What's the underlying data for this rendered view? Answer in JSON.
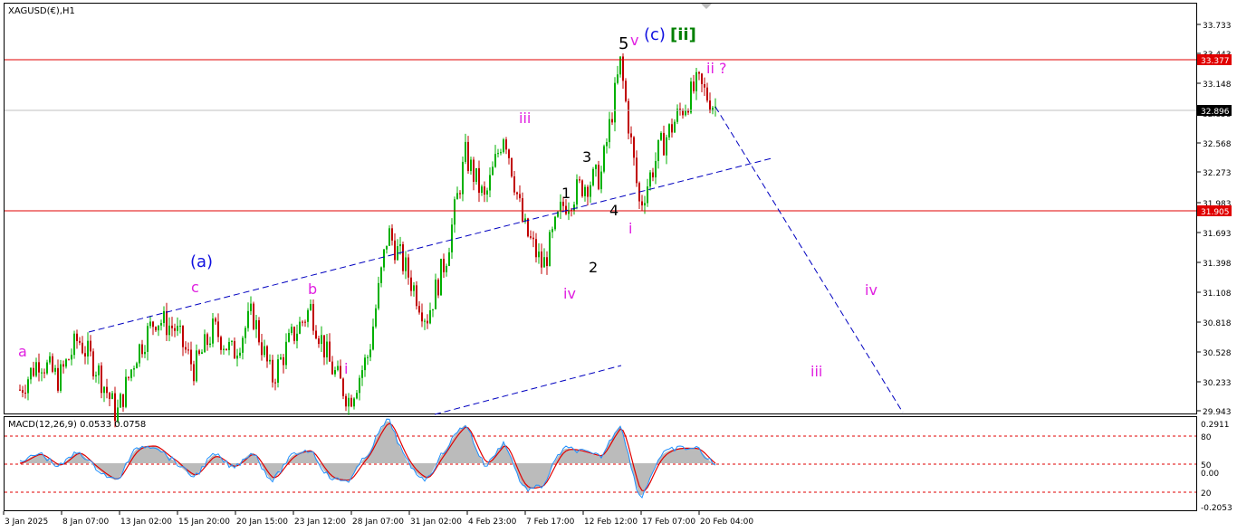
{
  "symbol_label": "XAGUSD(€),H1",
  "macd_label": "MACD(12,26,9) 0.0533 0.0758",
  "colors": {
    "bull": "#00b000",
    "bear": "#c00000",
    "wick": "#202020",
    "resistance": "#e00000",
    "price_line": "#c0c0c0",
    "channel": "#0000c0",
    "wave_pink": "#e020e0",
    "wave_blue": "#1010e0",
    "wave_green": "#008000",
    "wave_black": "#000000",
    "macd_hist": "#bbbbbb",
    "macd_signal": "#e00000",
    "macd_line": "#1e90ff"
  },
  "price_axis": {
    "ticks": [
      "33.733",
      "33.443",
      "33.148",
      "32.858",
      "32.568",
      "32.273",
      "31.983",
      "31.693",
      "31.398",
      "31.108",
      "30.818",
      "30.528",
      "30.233",
      "29.943"
    ],
    "range": [
      29.92,
      33.79
    ]
  },
  "price_tags": {
    "resistance_high": "33.377",
    "current": "32.896",
    "resistance_low": "31.905"
  },
  "macd_axis": {
    "ticks": [
      "0.2911",
      "80",
      "50",
      "0.00",
      "20",
      "-0.2053"
    ]
  },
  "time_axis": {
    "labels": [
      "3 Jan 2025",
      "8 Jan 07:00",
      "13 Jan 02:00",
      "15 Jan 20:00",
      "20 Jan 15:00",
      "23 Jan 12:00",
      "28 Jan 07:00",
      "31 Jan 02:00",
      "4 Feb 23:00",
      "7 Feb 17:00",
      "12 Feb 12:00",
      "17 Feb 07:00",
      "20 Feb 04:00"
    ]
  },
  "wave_labels": [
    {
      "text": "a",
      "color": "pink"
    },
    {
      "text": "(a)",
      "color": "blue"
    },
    {
      "text": "c",
      "color": "pink"
    },
    {
      "text": "b",
      "color": "pink"
    },
    {
      "text": "i",
      "color": "pink"
    },
    {
      "text": "iii",
      "color": "pink"
    },
    {
      "text": "1",
      "color": "black"
    },
    {
      "text": "2",
      "color": "black"
    },
    {
      "text": "iv",
      "color": "pink"
    },
    {
      "text": "3",
      "color": "black"
    },
    {
      "text": "4",
      "color": "black"
    },
    {
      "text": "i",
      "color": "pink"
    },
    {
      "text": "5",
      "color": "black"
    },
    {
      "text": "v",
      "color": "pink"
    },
    {
      "text": "(c)",
      "color": "blue"
    },
    {
      "text": "[ii]",
      "color": "green"
    },
    {
      "text": "ii ?",
      "color": "pink"
    },
    {
      "text": "iii",
      "color": "pink"
    },
    {
      "text": "iv",
      "color": "pink"
    }
  ],
  "chart_data": {
    "type": "candlestick",
    "title": "XAGUSD(€),H1",
    "y_range": [
      29.92,
      33.79
    ],
    "horizontal_lines": [
      33.377,
      32.896,
      31.905
    ],
    "price_path": [
      [
        "3 Jan 2025",
        30.15
      ],
      [
        "5 Jan",
        30.45
      ],
      [
        "8 Jan 07:00",
        30.25
      ],
      [
        "10 Jan",
        30.65
      ],
      [
        "11 Jan",
        30.35
      ],
      [
        "13 Jan 02:00",
        29.9
      ],
      [
        "14 Jan",
        30.5
      ],
      [
        "15 Jan",
        30.85
      ],
      [
        "15 Jan 20:00",
        30.75
      ],
      [
        "17 Jan",
        30.35
      ],
      [
        "19 Jan",
        30.75
      ],
      [
        "20 Jan 15:00",
        30.5
      ],
      [
        "21 Jan",
        30.9
      ],
      [
        "22 Jan",
        30.25
      ],
      [
        "23 Jan 12:00",
        30.65
      ],
      [
        "25 Jan",
        30.95
      ],
      [
        "26 Jan",
        30.4
      ],
      [
        "27 Jan",
        30.05
      ],
      [
        "28 Jan 07:00",
        30.5
      ],
      [
        "30 Jan",
        31.7
      ],
      [
        "31 Jan 02:00",
        31.3
      ],
      [
        "31 Jan 12:00",
        30.85
      ],
      [
        "2 Feb",
        31.45
      ],
      [
        "4 Feb 23:00",
        32.45
      ],
      [
        "6 Feb",
        32.0
      ],
      [
        "7 Feb",
        32.7
      ],
      [
        "7 Feb 17:00",
        31.75
      ],
      [
        "9 Feb",
        31.35
      ],
      [
        "10 Feb",
        31.95
      ],
      [
        "11 Feb",
        32.15
      ],
      [
        "12 Feb 12:00",
        32.25
      ],
      [
        "13 Feb",
        33.35
      ],
      [
        "14 Feb",
        31.95
      ],
      [
        "17 Feb 07:00",
        32.5
      ],
      [
        "19 Feb",
        32.85
      ],
      [
        "20 Feb 04:00",
        33.15
      ],
      [
        "20 Feb 10:00",
        32.9
      ]
    ],
    "projection_wave_path": [
      [
        33.05,
        "20 Feb"
      ],
      [
        29.94,
        "end"
      ]
    ],
    "macd": {
      "name": "MACD(12,26,9)",
      "value": 0.0533,
      "signal": 0.0758,
      "levels": [
        80,
        50,
        20
      ]
    }
  }
}
